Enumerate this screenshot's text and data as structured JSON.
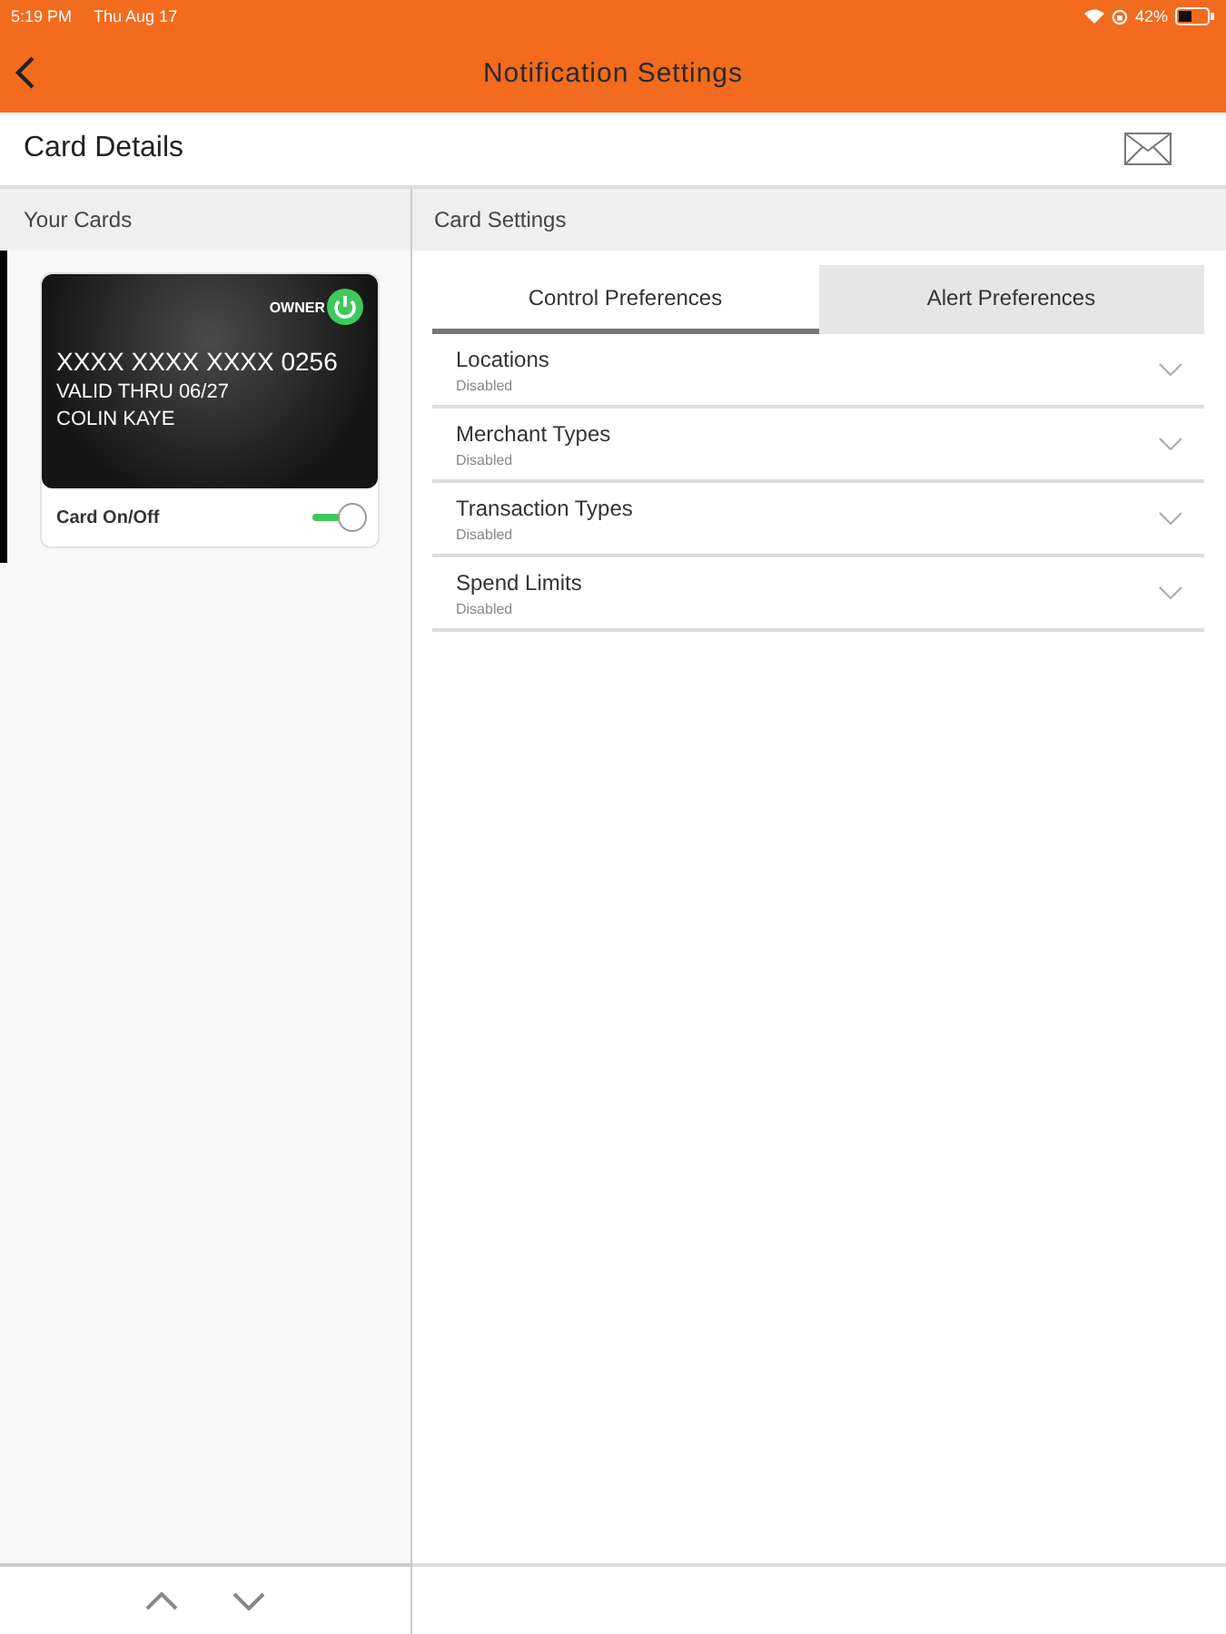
{
  "status_bar": {
    "time": "5:19 PM",
    "date": "Thu Aug 17",
    "battery": "42%"
  },
  "header": {
    "title": "Notification Settings"
  },
  "subheader": {
    "title": "Card Details"
  },
  "left_panel": {
    "title": "Your Cards",
    "cards": [
      {
        "badge": "OWNER",
        "number": "XXXX XXXX XXXX 0256",
        "valid": "VALID THRU 06/27",
        "holder": "COLIN KAYE",
        "toggle_label": "Card On/Off",
        "on": true,
        "selected": true
      }
    ]
  },
  "right_panel": {
    "title": "Card Settings",
    "tabs": [
      {
        "label": "Control Preferences",
        "selected": true
      },
      {
        "label": "Alert Preferences",
        "selected": false
      }
    ],
    "settings": [
      {
        "name": "Locations",
        "status": "Disabled"
      },
      {
        "name": "Merchant Types",
        "status": "Disabled"
      },
      {
        "name": "Transaction Types",
        "status": "Disabled"
      },
      {
        "name": "Spend Limits",
        "status": "Disabled"
      }
    ]
  }
}
